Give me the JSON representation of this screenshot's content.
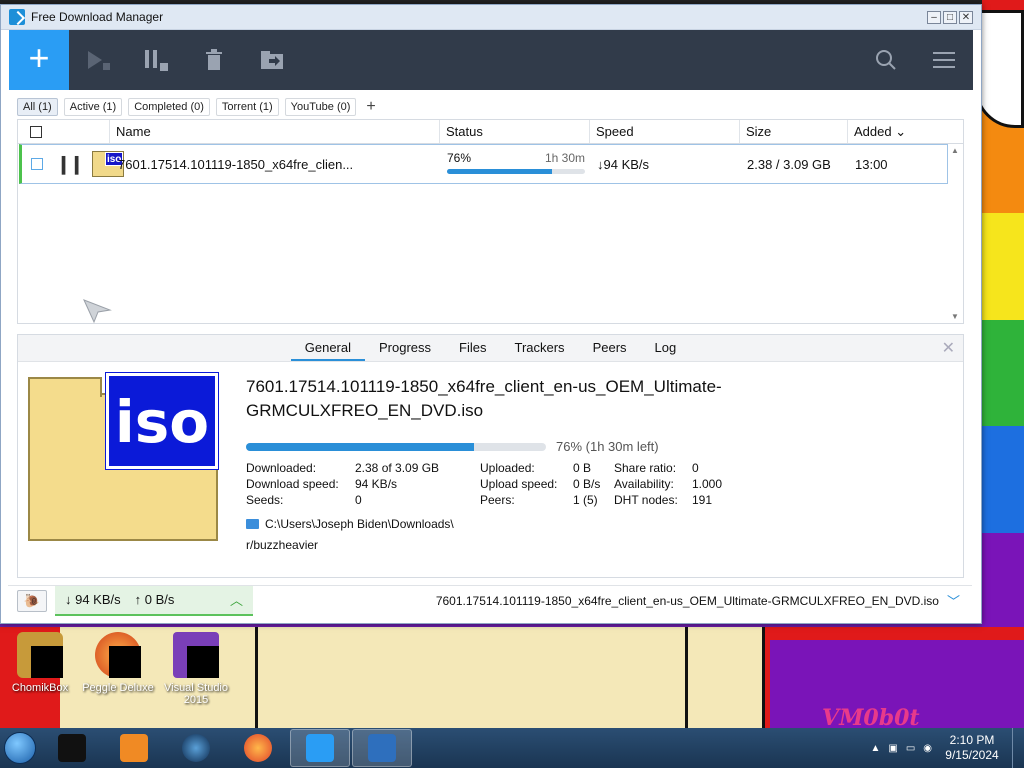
{
  "window": {
    "title": "Free Download Manager"
  },
  "toolbar": {
    "add_label": "+"
  },
  "filters": [
    {
      "label": "All (1)",
      "active": true
    },
    {
      "label": "Active (1)",
      "active": false
    },
    {
      "label": "Completed (0)",
      "active": false
    },
    {
      "label": "Torrent (1)",
      "active": false
    },
    {
      "label": "YouTube (0)",
      "active": false
    }
  ],
  "filters_add": "+",
  "columns": {
    "name": "Name",
    "status": "Status",
    "speed": "Speed",
    "size": "Size",
    "added": "Added ⌄"
  },
  "download": {
    "name": "7601.17514.101119-1850_x64fre_clien...",
    "progress_pct": "76%",
    "progress_value": 0.76,
    "time_left": "1h 30m",
    "speed": "↓94 KB/s",
    "size": "2.38 / 3.09 GB",
    "added": "13:00",
    "icon_label": "iso"
  },
  "details": {
    "tabs": [
      "General",
      "Progress",
      "Files",
      "Trackers",
      "Peers",
      "Log"
    ],
    "active_tab": "General",
    "close": "✕",
    "title": "7601.17514.101119-1850_x64fre_client_en-us_OEM_Ultimate-GRMCULXFREO_EN_DVD.iso",
    "progress_text": "76% (1h 30m left)",
    "icon_label": "iso",
    "stats": {
      "downloaded_label": "Downloaded:",
      "downloaded": "2.38 of 3.09 GB",
      "download_speed_label": "Download speed:",
      "download_speed": "94 KB/s",
      "seeds_label": "Seeds:",
      "seeds": "0",
      "uploaded_label": "Uploaded:",
      "uploaded": "0 B",
      "upload_speed_label": "Upload speed:",
      "upload_speed": "0 B/s",
      "peers_label": "Peers:",
      "peers": "1 (5)",
      "share_ratio_label": "Share ratio:",
      "share_ratio": "0",
      "availability_label": "Availability:",
      "availability": "1.000",
      "dht_nodes_label": "DHT nodes:",
      "dht_nodes": "191"
    },
    "path": "C:\\Users\\Joseph Biden\\Downloads\\",
    "tag": "r/buzzheavier"
  },
  "statusbar": {
    "down_speed": "↓ 94 KB/s",
    "up_speed": "↑ 0 B/s",
    "filename": "7601.17514.101119-1850_x64fre_client_en-us_OEM_Ultimate-GRMCULXFREO_EN_DVD.iso"
  },
  "desktop_icons": [
    {
      "label": "ChomikBox"
    },
    {
      "label": "Peggle Deluxe"
    },
    {
      "label": "Visual Studio 2015"
    }
  ],
  "wallpaper_text": "VM0b0t",
  "taskbar": {
    "time": "2:10 PM",
    "date": "9/15/2024"
  },
  "colors": {
    "accent": "#2a9df4",
    "toolbar_bg": "#313b4a",
    "active_green": "#4cc24c"
  }
}
